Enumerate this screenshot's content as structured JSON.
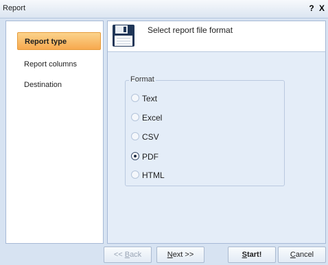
{
  "window": {
    "title": "Report",
    "help_label": "?",
    "close_label": "X"
  },
  "sidebar": {
    "items": [
      {
        "label": "Report type",
        "active": true
      },
      {
        "label": "Report columns",
        "active": false
      },
      {
        "label": "Destination",
        "active": false
      }
    ]
  },
  "header": {
    "icon": "floppy-disk-icon",
    "text": "Select report file format"
  },
  "format": {
    "label": "Format",
    "options": [
      {
        "label": "Text",
        "checked": false
      },
      {
        "label": "Excel",
        "checked": false
      },
      {
        "label": "CSV",
        "checked": false
      },
      {
        "label": "PDF",
        "checked": true
      },
      {
        "label": "HTML",
        "checked": false
      }
    ]
  },
  "footer": {
    "back": {
      "pre": "<< ",
      "key": "B",
      "post": "ack"
    },
    "next": {
      "key": "N",
      "post": "ext >>"
    },
    "start": {
      "pre": "",
      "key": "S",
      "post": "tart!"
    },
    "cancel": {
      "key": "C",
      "post": "ancel"
    }
  }
}
